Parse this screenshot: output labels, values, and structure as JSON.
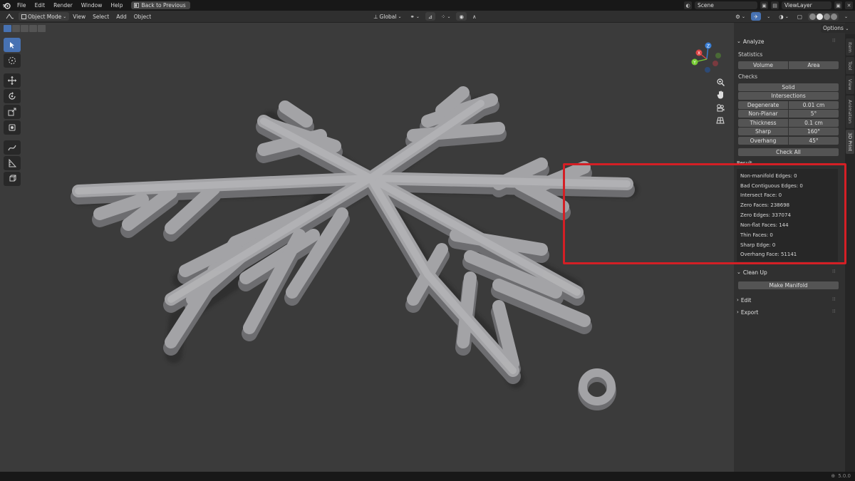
{
  "menu": {
    "file": "File",
    "edit": "Edit",
    "render": "Render",
    "window": "Window",
    "help": "Help",
    "back_button": "Back to Previous"
  },
  "top_right": {
    "scene": "Scene",
    "view_layer": "ViewLayer"
  },
  "header": {
    "mode": "Object Mode",
    "view": "View",
    "select": "Select",
    "add": "Add",
    "object": "Object",
    "orientation": "Global",
    "options": "Options"
  },
  "gizmo": {
    "x": "X",
    "y": "Y",
    "z": "Z"
  },
  "tabs": {
    "item": "Item",
    "tool": "Tool",
    "view": "View",
    "animation": "Animation",
    "print3d": "3D Print"
  },
  "analyze": {
    "title": "Analyze",
    "statistics": "Statistics",
    "volume": "Volume",
    "area": "Area",
    "checks": "Checks",
    "solid": "Solid",
    "intersections": "Intersections",
    "rows": [
      {
        "label": "Degenerate",
        "value": "0.01 cm"
      },
      {
        "label": "Non-Planar",
        "value": "5°"
      },
      {
        "label": "Thickness",
        "value": "0.1 cm"
      },
      {
        "label": "Sharp",
        "value": "160°"
      },
      {
        "label": "Overhang",
        "value": "45°"
      }
    ],
    "check_all": "Check All",
    "result_title": "Result"
  },
  "results": [
    "Non-manifold Edges: 0",
    "Bad Contiguous Edges: 0",
    "Intersect Face: 0",
    "Zero Faces: 238698",
    "Zero Edges: 337074",
    "Non-flat Faces: 144",
    "Thin Faces: 0",
    "Sharp Edge: 0",
    "Overhang Face: 51141"
  ],
  "cleanup": {
    "title": "Clean Up",
    "make_manifold": "Make Manifold"
  },
  "edit": {
    "title": "Edit"
  },
  "export": {
    "title": "Export"
  },
  "status": {
    "version": "5.0.0"
  },
  "colors": {
    "accent": "#4772b3",
    "highlight": "#d41f25",
    "mesh": "#9d9da0"
  }
}
